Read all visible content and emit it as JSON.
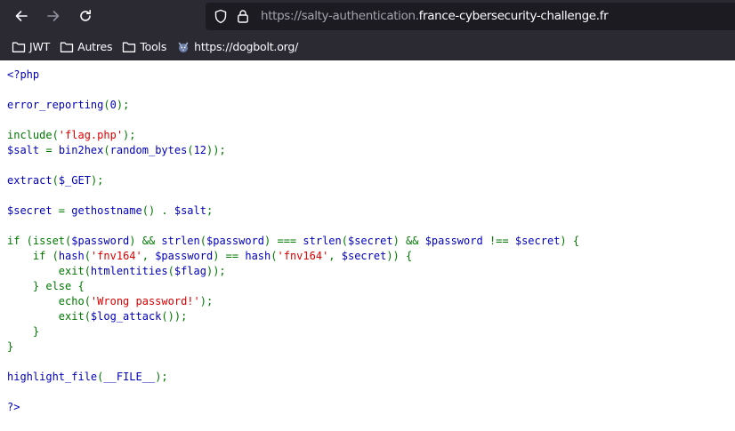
{
  "browser": {
    "url_prefix": "https://salty-authentication.",
    "url_domain": "france-cybersecurity-challenge.fr"
  },
  "bookmarks": [
    {
      "label": "JWT",
      "icon": "folder-icon"
    },
    {
      "label": "Autres",
      "icon": "folder-icon"
    },
    {
      "label": "Tools",
      "icon": "folder-icon"
    },
    {
      "label": "https://dogbolt.org/",
      "icon": "dogbolt-favicon"
    }
  ],
  "colors": {
    "chrome_bg": "#2b2a33",
    "urlbar_bg": "#1c1b22",
    "php_default": "#0000bb",
    "php_keyword": "#007700",
    "php_string": "#dd0000"
  },
  "code_lines": [
    [
      {
        "t": "<?php",
        "c": "kw"
      }
    ],
    [],
    [
      {
        "t": "error_reporting",
        "c": "kw"
      },
      {
        "t": "(",
        "c": "op"
      },
      {
        "t": "0",
        "c": "kw"
      },
      {
        "t": ");",
        "c": "op"
      }
    ],
    [],
    [
      {
        "t": "include(",
        "c": "op"
      },
      {
        "t": "'flag.php'",
        "c": "str"
      },
      {
        "t": ");",
        "c": "op"
      }
    ],
    [
      {
        "t": "$salt ",
        "c": "kw"
      },
      {
        "t": "= ",
        "c": "op"
      },
      {
        "t": "bin2hex",
        "c": "kw"
      },
      {
        "t": "(",
        "c": "op"
      },
      {
        "t": "random_bytes",
        "c": "kw"
      },
      {
        "t": "(",
        "c": "op"
      },
      {
        "t": "12",
        "c": "kw"
      },
      {
        "t": "));",
        "c": "op"
      }
    ],
    [],
    [
      {
        "t": "extract",
        "c": "kw"
      },
      {
        "t": "(",
        "c": "op"
      },
      {
        "t": "$_GET",
        "c": "kw"
      },
      {
        "t": ");",
        "c": "op"
      }
    ],
    [],
    [
      {
        "t": "$secret ",
        "c": "kw"
      },
      {
        "t": "= ",
        "c": "op"
      },
      {
        "t": "gethostname",
        "c": "kw"
      },
      {
        "t": "() . ",
        "c": "op"
      },
      {
        "t": "$salt",
        "c": "kw"
      },
      {
        "t": ";",
        "c": "op"
      }
    ],
    [],
    [
      {
        "t": "if (isset(",
        "c": "op"
      },
      {
        "t": "$password",
        "c": "kw"
      },
      {
        "t": ") && ",
        "c": "op"
      },
      {
        "t": "strlen",
        "c": "kw"
      },
      {
        "t": "(",
        "c": "op"
      },
      {
        "t": "$password",
        "c": "kw"
      },
      {
        "t": ") === ",
        "c": "op"
      },
      {
        "t": "strlen",
        "c": "kw"
      },
      {
        "t": "(",
        "c": "op"
      },
      {
        "t": "$secret",
        "c": "kw"
      },
      {
        "t": ") && ",
        "c": "op"
      },
      {
        "t": "$password ",
        "c": "kw"
      },
      {
        "t": "!== ",
        "c": "op"
      },
      {
        "t": "$secret",
        "c": "kw"
      },
      {
        "t": ") {",
        "c": "op"
      }
    ],
    [
      {
        "t": "    ",
        "c": "kw"
      },
      {
        "t": "if (",
        "c": "op"
      },
      {
        "t": "hash",
        "c": "kw"
      },
      {
        "t": "(",
        "c": "op"
      },
      {
        "t": "'fnv164'",
        "c": "str"
      },
      {
        "t": ", ",
        "c": "op"
      },
      {
        "t": "$password",
        "c": "kw"
      },
      {
        "t": ") == ",
        "c": "op"
      },
      {
        "t": "hash",
        "c": "kw"
      },
      {
        "t": "(",
        "c": "op"
      },
      {
        "t": "'fnv164'",
        "c": "str"
      },
      {
        "t": ", ",
        "c": "op"
      },
      {
        "t": "$secret",
        "c": "kw"
      },
      {
        "t": ")) {",
        "c": "op"
      }
    ],
    [
      {
        "t": "        ",
        "c": "kw"
      },
      {
        "t": "exit(",
        "c": "op"
      },
      {
        "t": "htmlentities",
        "c": "kw"
      },
      {
        "t": "(",
        "c": "op"
      },
      {
        "t": "$flag",
        "c": "kw"
      },
      {
        "t": "));",
        "c": "op"
      }
    ],
    [
      {
        "t": "    ",
        "c": "kw"
      },
      {
        "t": "} else {",
        "c": "op"
      }
    ],
    [
      {
        "t": "        ",
        "c": "kw"
      },
      {
        "t": "echo(",
        "c": "op"
      },
      {
        "t": "'Wrong password!'",
        "c": "str"
      },
      {
        "t": ");",
        "c": "op"
      }
    ],
    [
      {
        "t": "        ",
        "c": "kw"
      },
      {
        "t": "exit(",
        "c": "op"
      },
      {
        "t": "$log_attack",
        "c": "kw"
      },
      {
        "t": "());",
        "c": "op"
      }
    ],
    [
      {
        "t": "    ",
        "c": "kw"
      },
      {
        "t": "}",
        "c": "op"
      }
    ],
    [
      {
        "t": "}",
        "c": "op"
      }
    ],
    [],
    [
      {
        "t": "highlight_file",
        "c": "kw"
      },
      {
        "t": "(",
        "c": "op"
      },
      {
        "t": "__FILE__",
        "c": "kw"
      },
      {
        "t": ");",
        "c": "op"
      }
    ],
    [],
    [
      {
        "t": "?>",
        "c": "kw"
      }
    ]
  ]
}
